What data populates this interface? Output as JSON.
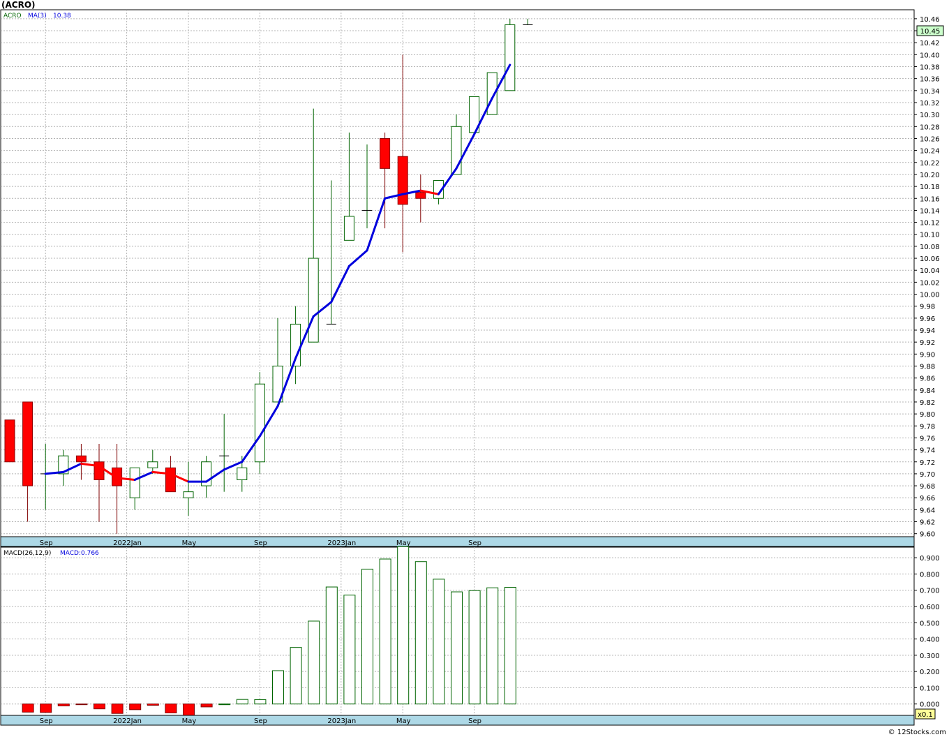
{
  "title": "(ACRO)",
  "copyright": "© 12Stocks.com",
  "colors": {
    "up": "#006400",
    "down": "#ff0000",
    "ma_up": "#0000dd",
    "ma_down": "#ff0000",
    "axis_band": "#add8e6",
    "grid": "#b4b4b4",
    "price_badge": "#ccffcc",
    "scale_badge": "#ffff99"
  },
  "price_panel": {
    "legend": {
      "ticker": "ACRO",
      "ma_label": "MA(3)",
      "ma_value": "10.38"
    },
    "last_price": "10.45",
    "ylim": [
      9.595,
      10.475
    ],
    "y_ticks": [
      "10.46",
      "10.44",
      "10.42",
      "10.40",
      "10.38",
      "10.36",
      "10.34",
      "10.32",
      "10.30",
      "10.28",
      "10.26",
      "10.24",
      "10.22",
      "10.20",
      "10.18",
      "10.16",
      "10.14",
      "10.12",
      "10.10",
      "10.08",
      "10.06",
      "10.04",
      "10.02",
      "10.00",
      "9.98",
      "9.96",
      "9.94",
      "9.92",
      "9.90",
      "9.88",
      "9.86",
      "9.84",
      "9.82",
      "9.80",
      "9.78",
      "9.76",
      "9.74",
      "9.72",
      "9.70",
      "9.68",
      "9.66",
      "9.64",
      "9.62",
      "9.60"
    ],
    "x_labels": [
      "Sep",
      "2022Jan",
      "May",
      "Sep",
      "2023Jan",
      "May",
      "Sep"
    ]
  },
  "macd_panel": {
    "legend": {
      "label": "MACD(26,12,9)",
      "value_label": "MACD:0.766"
    },
    "scale_label": "x0.1",
    "ylim": [
      -0.07,
      0.965
    ],
    "y_ticks": [
      "0.900",
      "0.800",
      "0.700",
      "0.600",
      "0.500",
      "0.400",
      "0.300",
      "0.200",
      "0.100",
      "0.000"
    ],
    "x_labels": [
      "Sep",
      "2022Jan",
      "May",
      "Sep",
      "2023Jan",
      "May",
      "Sep"
    ]
  },
  "chart_data": {
    "type": "candlestick",
    "interval": "monthly",
    "x": [
      "2021-07",
      "2021-08",
      "2021-09",
      "2021-10",
      "2021-11",
      "2021-12",
      "2022-01",
      "2022-02",
      "2022-03",
      "2022-04",
      "2022-05",
      "2022-06",
      "2022-07",
      "2022-08",
      "2022-09",
      "2022-10",
      "2022-11",
      "2022-12",
      "2023-01",
      "2023-02",
      "2023-03",
      "2023-04",
      "2023-05",
      "2023-06",
      "2023-07",
      "2023-08",
      "2023-09",
      "2023-10",
      "2023-11",
      "2023-12"
    ],
    "x_tick_labels": [
      {
        "x": "2021-09",
        "label": "Sep"
      },
      {
        "x": "2022-01",
        "label": "2022Jan"
      },
      {
        "x": "2022-05",
        "label": "May"
      },
      {
        "x": "2022-09",
        "label": "Sep"
      },
      {
        "x": "2023-01",
        "label": "2023Jan"
      },
      {
        "x": "2023-05",
        "label": "May"
      },
      {
        "x": "2023-09",
        "label": "Sep"
      }
    ],
    "open": [
      9.79,
      9.82,
      9.7,
      9.7,
      9.73,
      9.72,
      9.71,
      9.66,
      9.71,
      9.71,
      9.66,
      9.68,
      9.73,
      9.69,
      9.72,
      9.82,
      9.88,
      9.92,
      9.95,
      10.09,
      10.14,
      10.26,
      10.23,
      10.17,
      10.16,
      10.2,
      10.27,
      10.3,
      10.34,
      10.45
    ],
    "high": [
      9.79,
      9.82,
      9.75,
      9.74,
      9.75,
      9.75,
      9.75,
      9.71,
      9.74,
      9.73,
      9.72,
      9.73,
      9.8,
      9.73,
      9.87,
      9.96,
      9.98,
      10.31,
      10.19,
      10.27,
      10.25,
      10.27,
      10.4,
      10.2,
      10.18,
      10.3,
      10.33,
      10.37,
      10.46,
      10.46
    ],
    "low": [
      9.72,
      9.62,
      9.64,
      9.68,
      9.69,
      9.62,
      9.6,
      9.64,
      9.7,
      9.67,
      9.63,
      9.66,
      9.67,
      9.67,
      9.7,
      9.82,
      9.85,
      9.92,
      9.95,
      10.09,
      10.11,
      10.11,
      10.07,
      10.12,
      10.15,
      10.2,
      10.27,
      10.3,
      10.34,
      10.45
    ],
    "close": [
      9.72,
      9.68,
      9.7,
      9.73,
      9.72,
      9.69,
      9.68,
      9.71,
      9.72,
      9.67,
      9.67,
      9.72,
      9.73,
      9.71,
      9.85,
      9.88,
      9.95,
      10.06,
      9.95,
      10.13,
      10.14,
      10.21,
      10.15,
      10.16,
      10.19,
      10.28,
      10.33,
      10.37,
      10.45,
      10.45
    ],
    "ma3": [
      null,
      null,
      9.7,
      9.703,
      9.717,
      9.713,
      9.693,
      9.69,
      9.703,
      9.7,
      9.687,
      9.687,
      9.707,
      9.72,
      9.763,
      9.813,
      9.893,
      9.963,
      9.987,
      10.047,
      10.073,
      10.16,
      10.167,
      10.173,
      10.167,
      10.21,
      10.267,
      10.327,
      10.383,
      null
    ],
    "macd_x": [
      "2021-08",
      "2021-09",
      "2021-10",
      "2021-11",
      "2021-12",
      "2022-01",
      "2022-02",
      "2022-03",
      "2022-04",
      "2022-05",
      "2022-06",
      "2022-07",
      "2022-08",
      "2022-09",
      "2022-10",
      "2022-11",
      "2022-12",
      "2023-01",
      "2023-02",
      "2023-03",
      "2023-04",
      "2023-05",
      "2023-06",
      "2023-07",
      "2023-08",
      "2023-09",
      "2023-10",
      "2023-11"
    ],
    "macd": [
      -0.05,
      -0.052,
      -0.012,
      -0.002,
      -0.03,
      -0.058,
      -0.035,
      -0.008,
      -0.055,
      -0.068,
      -0.018,
      0.0,
      0.028,
      0.027,
      0.205,
      0.348,
      0.51,
      0.72,
      0.67,
      0.83,
      0.892,
      0.968,
      0.876,
      0.768,
      0.69,
      0.698,
      0.715,
      0.718
    ],
    "macd_last": 0.766
  }
}
